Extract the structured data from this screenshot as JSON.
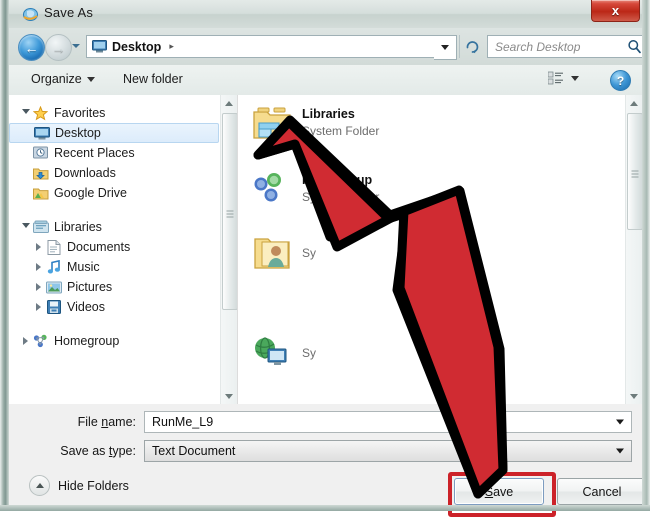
{
  "window": {
    "title": "Save As",
    "title_icon": "internet-explorer-icon",
    "close_label": "x"
  },
  "navbar": {
    "back_arrow": "←",
    "forward_arrow": "→",
    "breadcrumb_location": "Desktop",
    "breadcrumb_separator": "▸",
    "refresh_icon": "refresh-icon",
    "search_placeholder": "Search Desktop",
    "search_value": "",
    "search_icon": "search-icon"
  },
  "toolbar": {
    "organize_label": "Organize",
    "new_folder_label": "New folder",
    "view_icon": "view-mode-icon",
    "help_label": "?"
  },
  "sidebar": {
    "groups": [
      {
        "label": "Favorites",
        "icon": "star-icon",
        "expanded": true,
        "items": [
          {
            "label": "Desktop",
            "icon": "desktop-icon",
            "selected": true,
            "expandable": false
          },
          {
            "label": "Recent Places",
            "icon": "recent-places-icon",
            "selected": false,
            "expandable": false
          },
          {
            "label": "Downloads",
            "icon": "downloads-icon",
            "selected": false,
            "expandable": false
          },
          {
            "label": "Google Drive",
            "icon": "folder-icon",
            "selected": false,
            "expandable": false
          }
        ]
      },
      {
        "label": "Libraries",
        "icon": "libraries-icon",
        "expanded": true,
        "items": [
          {
            "label": "Documents",
            "icon": "document-icon",
            "selected": false,
            "expandable": true
          },
          {
            "label": "Music",
            "icon": "music-icon",
            "selected": false,
            "expandable": true
          },
          {
            "label": "Pictures",
            "icon": "pictures-icon",
            "selected": false,
            "expandable": true
          },
          {
            "label": "Videos",
            "icon": "videos-icon",
            "selected": false,
            "expandable": true
          }
        ]
      },
      {
        "label": "Homegroup",
        "icon": "homegroup-icon",
        "expanded": false,
        "items": []
      }
    ]
  },
  "file_list": {
    "items": [
      {
        "name": "Libraries",
        "subtitle": "System Folder",
        "icon": "libraries-folder-icon"
      },
      {
        "name": "Homegroup",
        "subtitle": "System Folder",
        "icon": "homegroup-icon"
      },
      {
        "name": "",
        "subtitle": "Sy",
        "icon": "user-folder-icon"
      },
      {
        "name": "",
        "subtitle": "Sy",
        "icon": "computer-network-icon"
      }
    ]
  },
  "form": {
    "file_name_label": "File name:",
    "file_name_label_pre": "File ",
    "file_name_label_accel": "n",
    "file_name_label_post": "ame:",
    "file_name_value": "RunMe_L9",
    "save_as_type_label": "Save as type:",
    "save_as_type_pre": "Save as ",
    "save_as_type_accel": "t",
    "save_as_type_post": "ype:",
    "save_as_type_value": "Text Document"
  },
  "footer": {
    "hide_folders_label": "Hide Folders",
    "save_label": "Save",
    "save_accel": "S",
    "save_rest": "ave",
    "cancel_label": "Cancel"
  },
  "annotation": {
    "arrow_color": "#d02b32",
    "arrow_outline": "#000000",
    "highlight_color": "#cc2229",
    "points_to": "Save"
  }
}
